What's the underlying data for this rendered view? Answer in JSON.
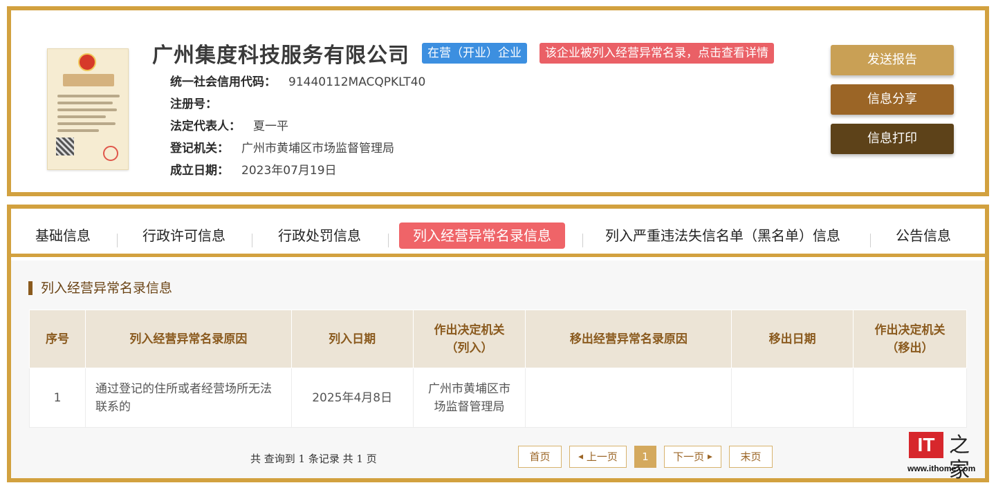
{
  "company": {
    "name": "广州集度科技服务有限公司",
    "status_badge": "在营（开业）企业",
    "alert_badge": "该企业被列入经营异常名录，点击查看详情",
    "fields": [
      {
        "key": "统一社会信用代码：",
        "value": "91440112MACQPKLT40"
      },
      {
        "key": "注册号：",
        "value": ""
      },
      {
        "key": "法定代表人：",
        "value": "夏一平"
      },
      {
        "key": "登记机关：",
        "value": "广州市黄埔区市场监督管理局"
      },
      {
        "key": "成立日期：",
        "value": "2023年07月19日"
      }
    ]
  },
  "actions": {
    "report": "发送报告",
    "share": "信息分享",
    "print": "信息打印"
  },
  "tabs": [
    "基础信息",
    "行政许可信息",
    "行政处罚信息",
    "列入经营异常名录信息",
    "列入严重违法失信名单（黑名单）信息",
    "公告信息"
  ],
  "active_tab": 3,
  "section": {
    "title": "列入经营异常名录信息",
    "columns": [
      "序号",
      "列入经营异常名录原因",
      "列入日期",
      "作出决定机关\n（列入）",
      "移出经营异常名录原因",
      "移出日期",
      "作出决定机关\n（移出）"
    ],
    "rows": [
      [
        "1",
        "通过登记的住所或者经营场所无法联系的",
        "2025年4月8日",
        "广州市黄埔区市场监督管理局",
        "",
        "",
        ""
      ]
    ]
  },
  "pager": {
    "summary": "共 查询到 1 条记录 共 1 页",
    "first": "首页",
    "prev": "上一页",
    "current": "1",
    "next": "下一页",
    "last": "末页"
  },
  "watermark": {
    "brand": "IT",
    "brand_cn": "之家",
    "url": "www.ithome.com"
  },
  "colors": {
    "gold": "#d2a13f",
    "status_blue": "#3c8fe0",
    "alert_red": "#ea6066",
    "active_tab": "#ef6468"
  }
}
